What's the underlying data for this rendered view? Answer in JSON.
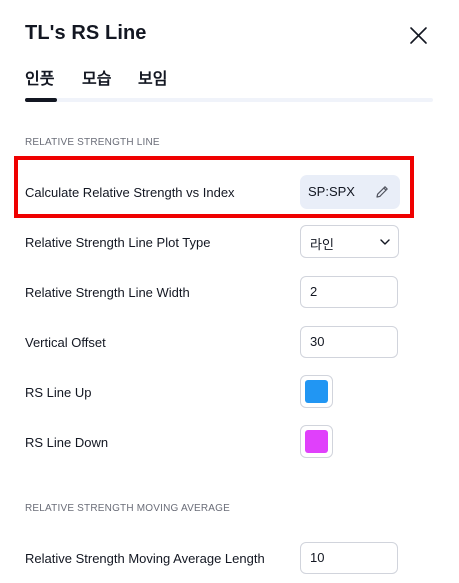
{
  "dialog": {
    "title": "TL's RS Line"
  },
  "tabs": [
    {
      "label": "인풋",
      "active": true
    },
    {
      "label": "모습",
      "active": false
    },
    {
      "label": "보임",
      "active": false
    }
  ],
  "sections": {
    "rs_line": "RELATIVE STRENGTH LINE",
    "rs_ma": "RELATIVE STRENGTH MOVING AVERAGE"
  },
  "fields": {
    "index": {
      "label": "Calculate Relative Strength vs Index",
      "value": "SP:SPX"
    },
    "plot_type": {
      "label": "Relative Strength Line Plot Type",
      "value": "라인"
    },
    "line_width": {
      "label": "Relative Strength Line Width",
      "value": "2"
    },
    "vertical_offset": {
      "label": "Vertical Offset",
      "value": "30"
    },
    "line_up": {
      "label": "RS Line Up",
      "color": "#2196f3"
    },
    "line_down": {
      "label": "RS Line Down",
      "color": "#e040fb"
    },
    "ma_length": {
      "label": "Relative Strength Moving Average Length",
      "value": "10"
    }
  },
  "icons": {
    "close": "close-icon",
    "edit": "pencil-icon",
    "dropdown": "chevron-down-icon"
  },
  "colors": {
    "highlight": "#ef0000",
    "tab_active": "#131722",
    "symbol_bg": "#e9eef8"
  }
}
